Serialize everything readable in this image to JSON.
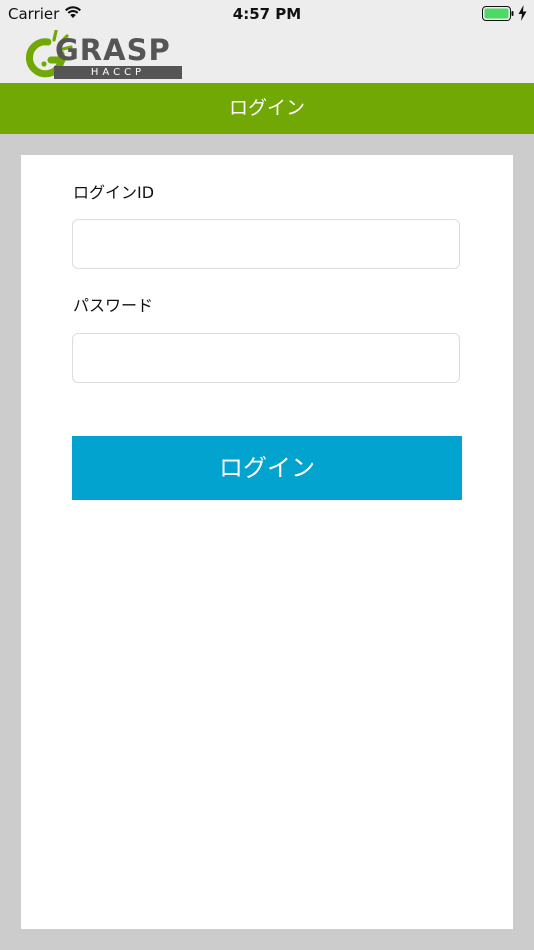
{
  "status_bar": {
    "carrier": "Carrier",
    "time": "4:57 PM",
    "battery_color": "#4cd964"
  },
  "logo": {
    "brand": "GRASP",
    "sub": "HACCP",
    "accent_color": "#72a806"
  },
  "nav": {
    "title": "ログイン",
    "bar_color": "#72a806"
  },
  "form": {
    "login_id_label": "ログインID",
    "login_id_value": "",
    "password_label": "パスワード",
    "password_value": "",
    "submit_label": "ログイン",
    "submit_color": "#03a3cf"
  }
}
